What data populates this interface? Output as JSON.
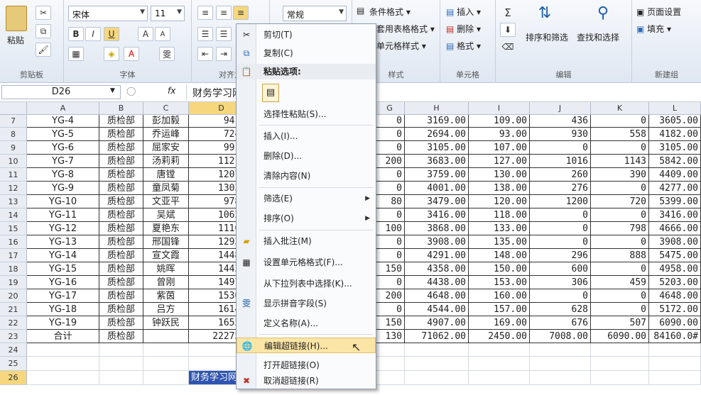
{
  "ribbon": {
    "clipboard": {
      "paste": "粘贴",
      "label": "剪贴板"
    },
    "font": {
      "name": "宋体",
      "size": "11",
      "bold": "B",
      "italic": "I",
      "underline": "U",
      "grow": "A",
      "shrink": "A",
      "wen": "雯",
      "label": "字体"
    },
    "align": {
      "label": "对齐方"
    },
    "number": {
      "format": "常规",
      "label": "数"
    },
    "styles": {
      "cond": "条件格式",
      "table": "套用表格格式",
      "cell": "单元格样式",
      "label": "样式"
    },
    "cells": {
      "insert": "插入",
      "delete": "删除",
      "format": "格式",
      "label": "单元格"
    },
    "editing": {
      "sort": "排序和筛选",
      "find": "查找和选择",
      "label": "编辑"
    },
    "newgroup": {
      "page": "页面设置",
      "fill": "填充",
      "label": "新建组"
    }
  },
  "formula": {
    "namebox": "D26",
    "fx": "fx",
    "value": "财务学习网"
  },
  "columns": [
    "A",
    "B",
    "C",
    "D",
    "E",
    "F",
    "G",
    "H",
    "I",
    "J",
    "K",
    "L"
  ],
  "rows": [
    {
      "n": "7",
      "a": "YG-4",
      "b": "质检部",
      "c": "彭加毅",
      "d": "941.0",
      "g": "0",
      "h": "3169.00",
      "i": "109.00",
      "j": "436",
      "k": "0",
      "l": "3605.00"
    },
    {
      "n": "8",
      "a": "YG-5",
      "b": "质检部",
      "c": "乔运峰",
      "d": "724.0",
      "g": "0",
      "h": "2694.00",
      "i": "93.00",
      "j": "930",
      "k": "558",
      "l": "4182.00"
    },
    {
      "n": "9",
      "a": "YG-6",
      "b": "质检部",
      "c": "屈家安",
      "d": "991.0",
      "g": "0",
      "h": "3105.00",
      "i": "107.00",
      "j": "0",
      "k": "0",
      "l": "3105.00"
    },
    {
      "n": "10",
      "a": "YG-7",
      "b": "质检部",
      "c": "汤莉莉",
      "d": "1121.0",
      "g": "200",
      "h": "3683.00",
      "i": "127.00",
      "j": "1016",
      "k": "1143",
      "l": "5842.00"
    },
    {
      "n": "11",
      "a": "YG-8",
      "b": "质检部",
      "c": "唐镗",
      "d": "1207.0",
      "g": "0",
      "h": "3759.00",
      "i": "130.00",
      "j": "260",
      "k": "390",
      "l": "4409.00"
    },
    {
      "n": "12",
      "a": "YG-9",
      "b": "质检部",
      "c": "童凤菊",
      "d": "1303.0",
      "g": "0",
      "h": "4001.00",
      "i": "138.00",
      "j": "276",
      "k": "0",
      "l": "4277.00"
    },
    {
      "n": "13",
      "a": "YG-10",
      "b": "质检部",
      "c": "文亚平",
      "d": "978.0",
      "g": "80",
      "h": "3479.00",
      "i": "120.00",
      "j": "1200",
      "k": "720",
      "l": "5399.00"
    },
    {
      "n": "14",
      "a": "YG-11",
      "b": "质检部",
      "c": "吴斌",
      "d": "1062.0",
      "g": "0",
      "h": "3416.00",
      "i": "118.00",
      "j": "0",
      "k": "0",
      "l": "3416.00"
    },
    {
      "n": "15",
      "a": "YG-12",
      "b": "质检部",
      "c": "夏艳东",
      "d": "1110.0",
      "g": "100",
      "h": "3868.00",
      "i": "133.00",
      "j": "0",
      "k": "798",
      "l": "4666.00"
    },
    {
      "n": "16",
      "a": "YG-13",
      "b": "质检部",
      "c": "邢国锋",
      "d": "1293.0",
      "g": "0",
      "h": "3908.00",
      "i": "135.00",
      "j": "0",
      "k": "0",
      "l": "3908.00"
    },
    {
      "n": "17",
      "a": "YG-14",
      "b": "质检部",
      "c": "宣文霞",
      "d": "1448.0",
      "g": "0",
      "h": "4291.00",
      "i": "148.00",
      "j": "296",
      "k": "888",
      "l": "5475.00"
    },
    {
      "n": "18",
      "a": "YG-15",
      "b": "质检部",
      "c": "姚晖",
      "d": "1443.0",
      "g": "150",
      "h": "4358.00",
      "i": "150.00",
      "j": "600",
      "k": "0",
      "l": "4958.00"
    },
    {
      "n": "19",
      "a": "YG-16",
      "b": "质检部",
      "c": "曾刚",
      "d": "1497.0",
      "g": "0",
      "h": "4438.00",
      "i": "153.00",
      "j": "306",
      "k": "459",
      "l": "5203.00"
    },
    {
      "n": "20",
      "a": "YG-17",
      "b": "质检部",
      "c": "紫茵",
      "d": "1536.0",
      "g": "200",
      "h": "4648.00",
      "i": "160.00",
      "j": "0",
      "k": "0",
      "l": "4648.00"
    },
    {
      "n": "21",
      "a": "YG-18",
      "b": "质检部",
      "c": "吕方",
      "d": "1614.0",
      "g": "0",
      "h": "4544.00",
      "i": "157.00",
      "j": "628",
      "k": "0",
      "l": "5172.00"
    },
    {
      "n": "22",
      "a": "YG-19",
      "b": "质检部",
      "c": "钟跃民",
      "d": "1655.0",
      "g": "150",
      "h": "4907.00",
      "i": "169.00",
      "j": "676",
      "k": "507",
      "l": "6090.00"
    },
    {
      "n": "23",
      "a": "合计",
      "b": "质检部",
      "c": "",
      "d": "22275.0",
      "g": "130",
      "h": "71062.00",
      "i": "2450.00",
      "j": "7008.00",
      "k": "6090.00",
      "l": "84160.0#"
    },
    {
      "n": "24",
      "a": "",
      "b": "",
      "c": "",
      "d": "",
      "g": "",
      "h": "",
      "i": "",
      "j": "",
      "k": "",
      "l": ""
    },
    {
      "n": "25",
      "a": "",
      "b": "",
      "c": "",
      "d": "",
      "g": "",
      "h": "",
      "i": "",
      "j": "",
      "k": "",
      "l": ""
    },
    {
      "n": "26",
      "a": "",
      "b": "",
      "c": "",
      "d": "财务学习网",
      "g": "",
      "h": "",
      "i": "",
      "j": "",
      "k": "",
      "l": ""
    }
  ],
  "menu": {
    "cut": "剪切(T)",
    "copy": "复制(C)",
    "paste_options": "粘贴选项:",
    "paste_special": "选择性粘贴(S)...",
    "insert": "插入(I)...",
    "delete": "删除(D)...",
    "clear": "清除内容(N)",
    "filter": "筛选(E)",
    "sort": "排序(O)",
    "comment": "插入批注(M)",
    "format_cells": "设置单元格格式(F)...",
    "pick_list": "从下拉列表中选择(K)...",
    "phonetic": "显示拼音字段(S)",
    "define_name": "定义名称(A)...",
    "edit_link": "编辑超链接(H)...",
    "open_link": "打开超链接(O)",
    "remove_link": "取消超链接(R)"
  }
}
